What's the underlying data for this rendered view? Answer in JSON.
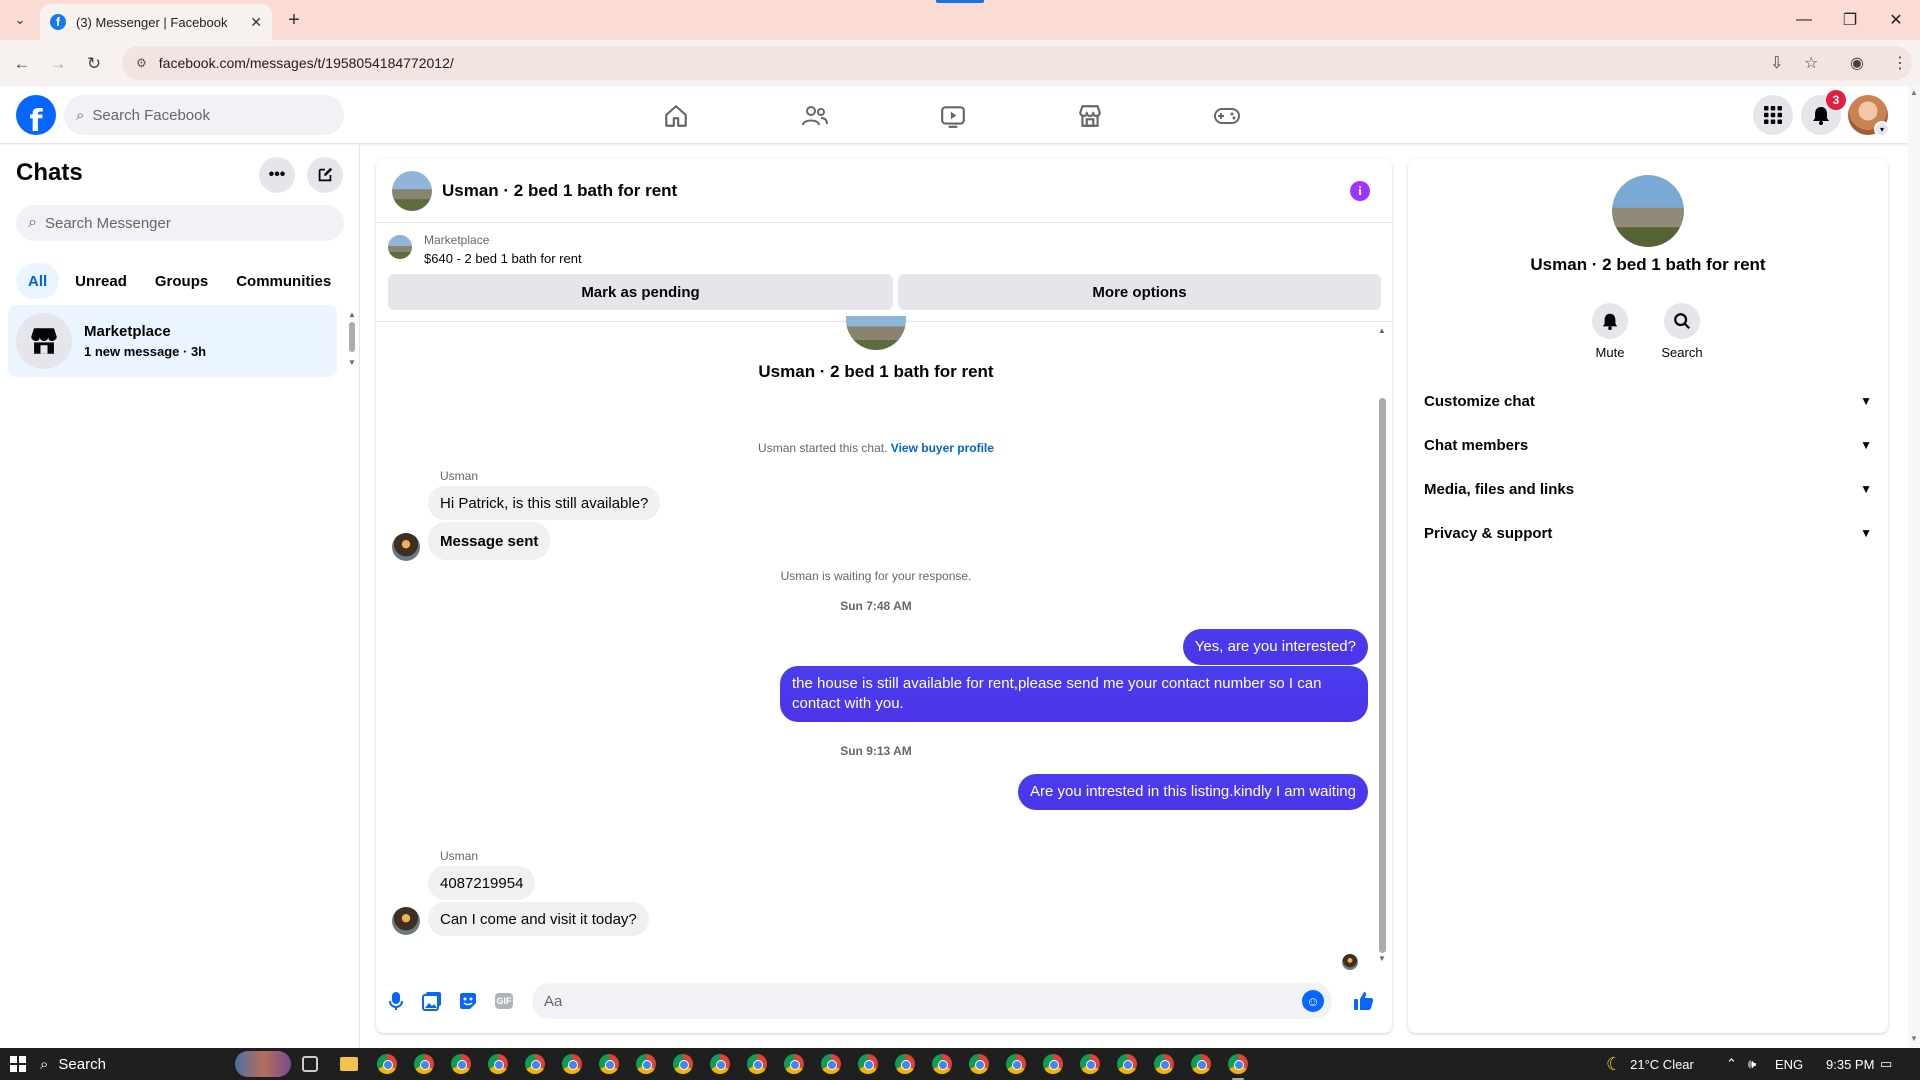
{
  "browser": {
    "tab_title": "(3) Messenger | Facebook",
    "url": "facebook.com/messages/t/1958054184772012/"
  },
  "fb": {
    "search_placeholder": "Search Facebook",
    "notification_count": "3"
  },
  "left": {
    "title": "Chats",
    "search_placeholder": "Search Messenger",
    "filters": [
      "All",
      "Unread",
      "Groups",
      "Communities"
    ],
    "chat": {
      "name": "Marketplace",
      "preview": "1 new message · 3h"
    }
  },
  "convo": {
    "title": "Usman · 2 bed 1 bath for rent",
    "listing_label": "Marketplace",
    "listing_price": "$640 - 2 bed 1 bath for rent",
    "btn_pending": "Mark as pending",
    "btn_more": "More options",
    "thread_name": "Usman · 2 bed 1 bath for rent",
    "started": "Usman started this chat.",
    "view_profile": "View buyer profile",
    "sender1": "Usman",
    "msg1": "Hi Patrick, is this still available?",
    "msg2": "Message sent",
    "waiting": "Usman is waiting for your response.",
    "ts1": "Sun 7:48 AM",
    "out1": "Yes, are you interested?",
    "out2": "the house is still available for rent,please send me your contact number so I can contact with you.",
    "ts2": "Sun 9:13 AM",
    "out3": "Are you intrested in this listing.kindly I am waiting",
    "sender2": "Usman",
    "msg3": "4087219954",
    "msg4": "Can I come and visit it today?",
    "composer_placeholder": "Aa",
    "gif_label": "GIF"
  },
  "details": {
    "name": "Usman · 2 bed 1 bath for rent",
    "mute": "Mute",
    "search": "Search",
    "sections": [
      "Customize chat",
      "Chat members",
      "Media, files and links",
      "Privacy & support"
    ]
  },
  "taskbar": {
    "search": "Search",
    "weather": "21°C  Clear",
    "lang": "ENG",
    "time": "9:35 PM"
  },
  "colors": {
    "accent": "#0866ff",
    "outgoing_bubble": "#4c34e8",
    "incoming_bubble": "#f0f0f0",
    "notification": "#e41e3f",
    "info": "#a033ff"
  }
}
